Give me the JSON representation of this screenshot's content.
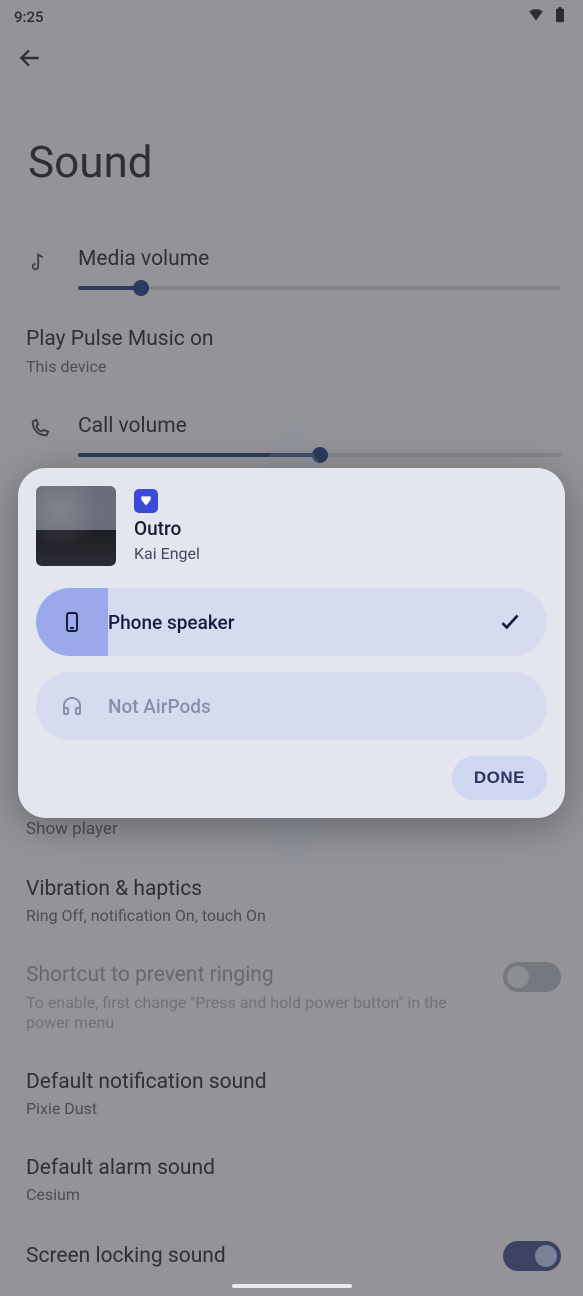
{
  "status": {
    "time": "9:25"
  },
  "page": {
    "title": "Sound"
  },
  "items": {
    "media_volume": {
      "title": "Media volume",
      "percent": 13
    },
    "play_on": {
      "title": "Play Pulse Music on",
      "sub": "This device"
    },
    "call_volume": {
      "title": "Call volume",
      "percent": 50
    },
    "show_player": {
      "title": "Show player"
    },
    "vibration": {
      "title": "Vibration & haptics",
      "sub": "Ring Off, notification On, touch On"
    },
    "shortcut": {
      "title": "Shortcut to prevent ringing",
      "sub": "To enable, first change \"Press and hold power button\" in the power menu"
    },
    "notif_sound": {
      "title": "Default notification sound",
      "sub": "Pixie Dust"
    },
    "alarm_sound": {
      "title": "Default alarm sound",
      "sub": "Cesium"
    },
    "screen_lock": {
      "title": "Screen locking sound"
    }
  },
  "dialog": {
    "track": "Outro",
    "artist": "Kai Engel",
    "outputs": [
      {
        "label": "Phone speaker",
        "selected": true,
        "icon": "phone"
      },
      {
        "label": "Not AirPods",
        "selected": false,
        "icon": "headphones"
      }
    ],
    "done": "DONE"
  }
}
